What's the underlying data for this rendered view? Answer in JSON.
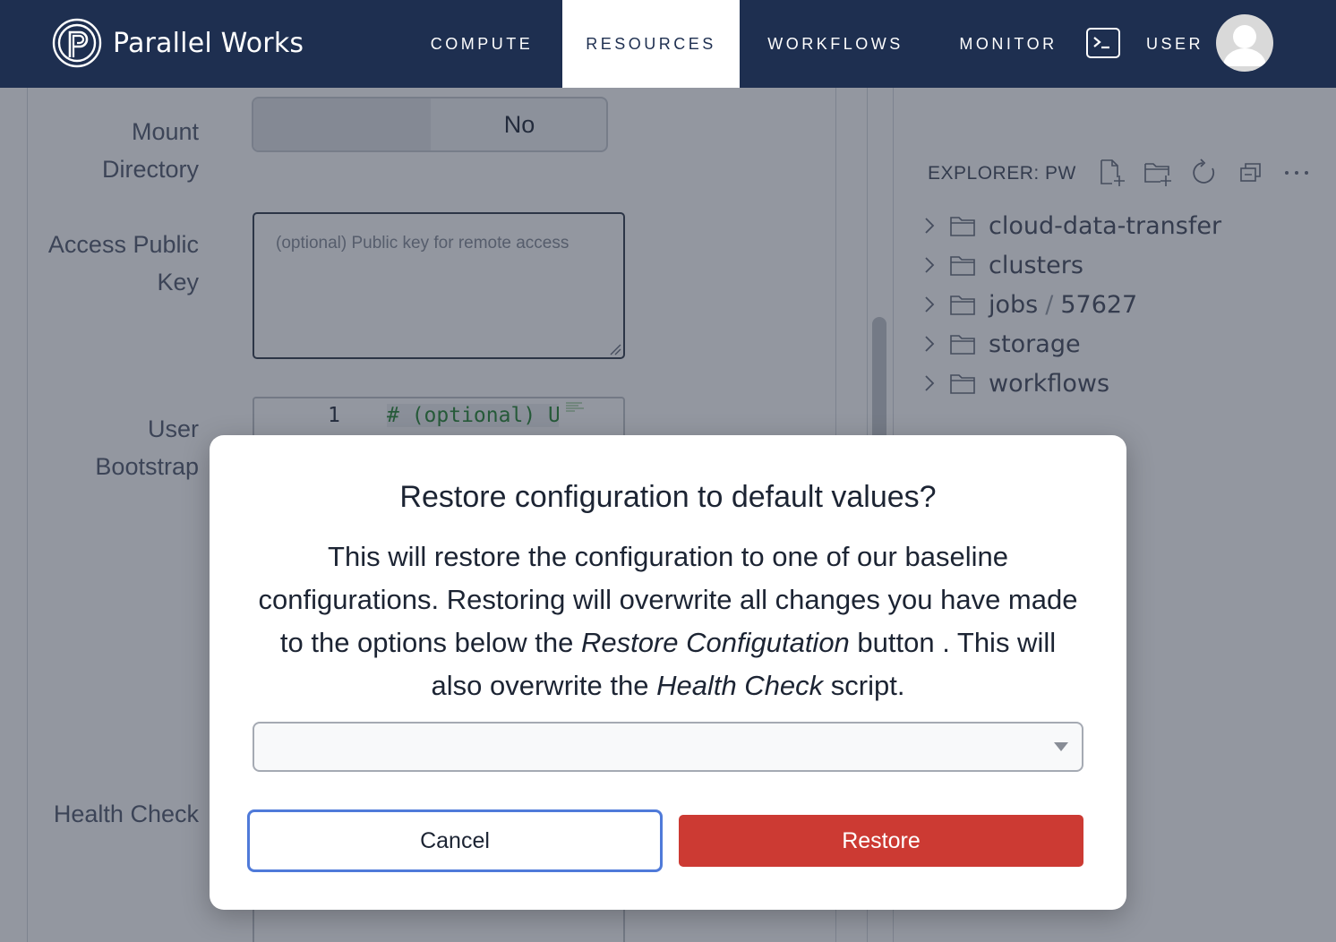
{
  "nav": {
    "brand": "Parallel Works",
    "items": [
      {
        "label": "COMPUTE",
        "active": false
      },
      {
        "label": "RESOURCES",
        "active": true
      },
      {
        "label": "WORKFLOWS",
        "active": false
      },
      {
        "label": "MONITOR",
        "active": false
      }
    ],
    "terminal_icon": "terminal-icon",
    "user_label": "USER",
    "avatar_icon": "user-avatar-icon"
  },
  "form": {
    "mount_directory": {
      "label_line1": "Mount",
      "label_line2": "Directory",
      "value": "No"
    },
    "access_public_key": {
      "label_line1": "Access Public",
      "label_line2": "Key",
      "placeholder": "(optional) Public key for remote access"
    },
    "user_bootstrap": {
      "label_line1": "User",
      "label_line2": "Bootstrap",
      "line_number": "1",
      "code": "# (optional) U"
    },
    "health_check": {
      "label": "Health Check"
    }
  },
  "explorer": {
    "title": "EXPLORER: PW",
    "actions": [
      "new-file-icon",
      "new-folder-icon",
      "refresh-icon",
      "collapse-all-icon",
      "more-icon"
    ],
    "items": [
      {
        "name": "cloud-data-transfer"
      },
      {
        "name": "clusters"
      },
      {
        "name": "jobs",
        "suffix": "57627"
      },
      {
        "name": "storage"
      },
      {
        "name": "workflows"
      }
    ],
    "jobs_separator": "/"
  },
  "modal": {
    "title": "Restore configuration to default values?",
    "body_part1": "This will restore the configuration to one of our baseline configurations. Restoring will overwrite all changes you have made to the options below the ",
    "body_em1": "Restore Configutation",
    "body_part2": " button . This will also overwrite the ",
    "body_em2": "Health Check",
    "body_part3": " script.",
    "select_value": "",
    "cancel_label": "Cancel",
    "restore_label": "Restore",
    "colors": {
      "restore": "#cc3a33",
      "cancel_border": "#4f7ad9",
      "nav_bg": "#1e2f50"
    }
  }
}
